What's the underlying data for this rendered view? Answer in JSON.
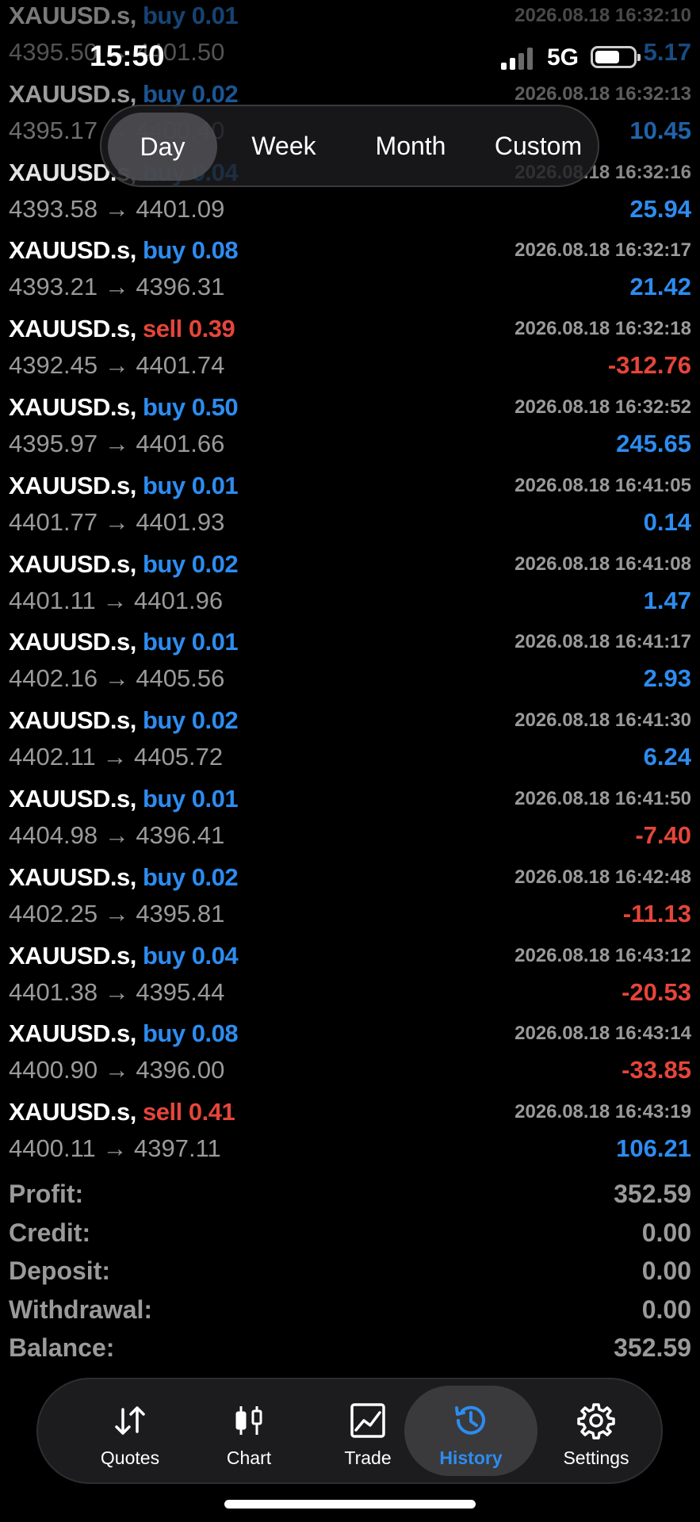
{
  "status": {
    "time": "15:50",
    "network": "5G"
  },
  "period_tabs": [
    {
      "label": "Day",
      "active": true
    },
    {
      "label": "Week",
      "active": false
    },
    {
      "label": "Month",
      "active": false
    },
    {
      "label": "Custom",
      "active": false
    }
  ],
  "trades": [
    {
      "symbol": "XAUUSD.s,",
      "direction": "buy",
      "volume": "0.01",
      "time": "2026.08.18 16:32:10",
      "open": "4395.50",
      "close": "4401.50",
      "profit": "5.17"
    },
    {
      "symbol": "XAUUSD.s,",
      "direction": "buy",
      "volume": "0.02",
      "time": "2026.08.18 16:32:13",
      "open": "4395.17",
      "close": "4400.40",
      "profit": "10.45"
    },
    {
      "symbol": "XAUUSD.s,",
      "direction": "buy",
      "volume": "0.04",
      "time": "2026.08.18 16:32:16",
      "open": "4393.58",
      "close": "4401.09",
      "profit": "25.94"
    },
    {
      "symbol": "XAUUSD.s,",
      "direction": "buy",
      "volume": "0.08",
      "time": "2026.08.18 16:32:17",
      "open": "4393.21",
      "close": "4396.31",
      "profit": "21.42"
    },
    {
      "symbol": "XAUUSD.s,",
      "direction": "sell",
      "volume": "0.39",
      "time": "2026.08.18 16:32:18",
      "open": "4392.45",
      "close": "4401.74",
      "profit": "-312.76"
    },
    {
      "symbol": "XAUUSD.s,",
      "direction": "buy",
      "volume": "0.50",
      "time": "2026.08.18 16:32:52",
      "open": "4395.97",
      "close": "4401.66",
      "profit": "245.65"
    },
    {
      "symbol": "XAUUSD.s,",
      "direction": "buy",
      "volume": "0.01",
      "time": "2026.08.18 16:41:05",
      "open": "4401.77",
      "close": "4401.93",
      "profit": "0.14"
    },
    {
      "symbol": "XAUUSD.s,",
      "direction": "buy",
      "volume": "0.02",
      "time": "2026.08.18 16:41:08",
      "open": "4401.11",
      "close": "4401.96",
      "profit": "1.47"
    },
    {
      "symbol": "XAUUSD.s,",
      "direction": "buy",
      "volume": "0.01",
      "time": "2026.08.18 16:41:17",
      "open": "4402.16",
      "close": "4405.56",
      "profit": "2.93"
    },
    {
      "symbol": "XAUUSD.s,",
      "direction": "buy",
      "volume": "0.02",
      "time": "2026.08.18 16:41:30",
      "open": "4402.11",
      "close": "4405.72",
      "profit": "6.24"
    },
    {
      "symbol": "XAUUSD.s,",
      "direction": "buy",
      "volume": "0.01",
      "time": "2026.08.18 16:41:50",
      "open": "4404.98",
      "close": "4396.41",
      "profit": "-7.40"
    },
    {
      "symbol": "XAUUSD.s,",
      "direction": "buy",
      "volume": "0.02",
      "time": "2026.08.18 16:42:48",
      "open": "4402.25",
      "close": "4395.81",
      "profit": "-11.13"
    },
    {
      "symbol": "XAUUSD.s,",
      "direction": "buy",
      "volume": "0.04",
      "time": "2026.08.18 16:43:12",
      "open": "4401.38",
      "close": "4395.44",
      "profit": "-20.53"
    },
    {
      "symbol": "XAUUSD.s,",
      "direction": "buy",
      "volume": "0.08",
      "time": "2026.08.18 16:43:14",
      "open": "4400.90",
      "close": "4396.00",
      "profit": "-33.85"
    },
    {
      "symbol": "XAUUSD.s,",
      "direction": "sell",
      "volume": "0.41",
      "time": "2026.08.18 16:43:19",
      "open": "4400.11",
      "close": "4397.11",
      "profit": "106.21"
    }
  ],
  "arrow": "→",
  "summary": [
    {
      "label": "Profit:",
      "value": "352.59"
    },
    {
      "label": "Credit:",
      "value": "0.00"
    },
    {
      "label": "Deposit:",
      "value": "0.00"
    },
    {
      "label": "Withdrawal:",
      "value": "0.00"
    },
    {
      "label": "Balance:",
      "value": "352.59"
    }
  ],
  "tabbar": [
    {
      "label": "Quotes",
      "icon": "quotes-arrows-icon",
      "active": false
    },
    {
      "label": "Chart",
      "icon": "candlestick-icon",
      "active": false
    },
    {
      "label": "Trade",
      "icon": "trade-chart-icon",
      "active": false
    },
    {
      "label": "History",
      "icon": "history-clock-icon",
      "active": true
    },
    {
      "label": "Settings",
      "icon": "gear-icon",
      "active": false
    }
  ],
  "colors": {
    "buy": "#2d8cf0",
    "sell": "#e6453a",
    "accent": "#2d8cf0",
    "muted": "#9a9a9a"
  }
}
